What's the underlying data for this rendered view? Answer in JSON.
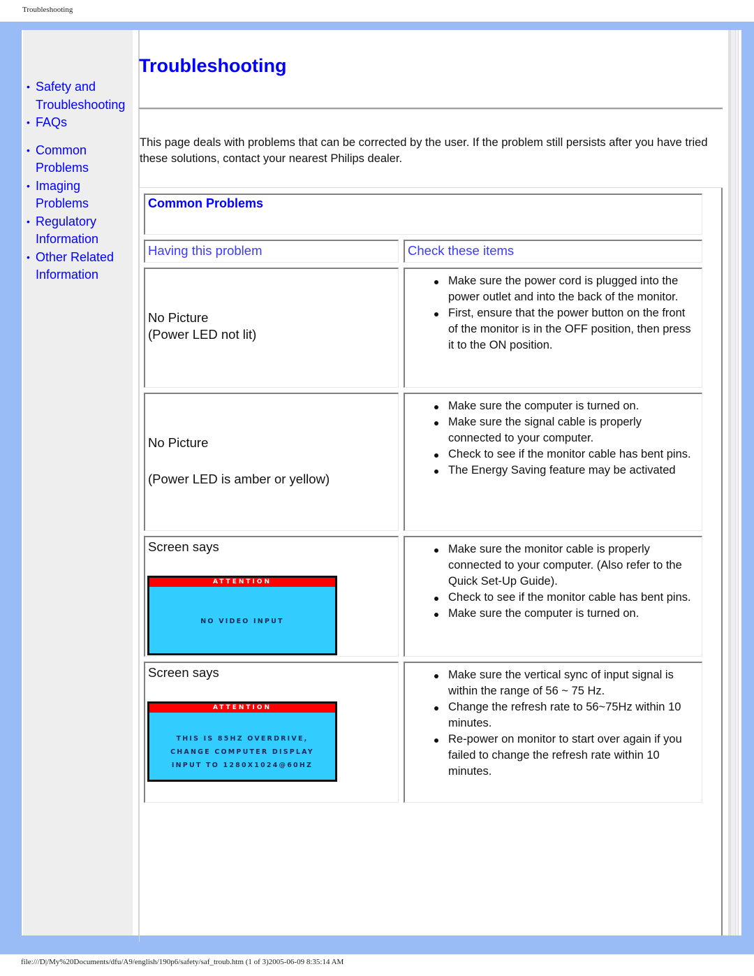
{
  "print_header": "Troubleshooting",
  "print_footer": "file:///D|/My%20Documents/dfu/A9/english/190p6/safety/saf_troub.htm (1 of 3)2005-06-09 8:35:14 AM",
  "sidebar": {
    "items": [
      {
        "label": "Safety and Troubleshooting"
      },
      {
        "label": "FAQs"
      },
      {
        "label": "Common Problems"
      },
      {
        "label": "Imaging Problems"
      },
      {
        "label": "Regulatory Information"
      },
      {
        "label": "Other Related Information"
      }
    ],
    "bullet": "•"
  },
  "page": {
    "title": "Troubleshooting",
    "intro": "This page deals with problems that can be corrected by the user. If the problem still persists after you have tried these solutions, contact your nearest Philips dealer."
  },
  "table": {
    "section_title": "Common Problems",
    "col_problem": "Having this problem",
    "col_check": "Check these items",
    "rows": [
      {
        "problem_lines": [
          "No Picture",
          "(Power LED not lit)"
        ],
        "checks": [
          "Make sure the power cord is plugged into the power outlet and into the back of the monitor.",
          "First, ensure that the power button on the front of the monitor is in the OFF position, then press it to the ON position."
        ]
      },
      {
        "problem_lines": [
          "No Picture",
          "(Power LED is amber or yellow)"
        ],
        "checks": [
          "Make sure the computer is turned on.",
          "Make sure the signal cable is properly connected to your computer.",
          "Check to see if the monitor cable has bent pins.",
          "The Energy Saving feature may be activated"
        ]
      },
      {
        "problem_lines": [
          "Screen says"
        ],
        "osd": {
          "header": "ATTENTION",
          "lines": [
            "NO VIDEO INPUT"
          ]
        },
        "checks": [
          "Make sure the monitor cable is properly connected to your computer. (Also refer to the Quick Set-Up Guide).",
          "Check to see if the monitor cable has bent pins.",
          "Make sure the computer is turned on."
        ]
      },
      {
        "problem_lines": [
          "Screen says"
        ],
        "osd": {
          "header": "ATTENTION",
          "lines": [
            "THIS IS 85HZ OVERDRIVE,",
            "CHANGE COMPUTER DISPLAY",
            "INPUT TO 1280X1024@60HZ"
          ]
        },
        "checks": [
          "Make sure the vertical sync of input signal is within the range of 56 ~ 75 Hz.",
          "Change the refresh rate to 56~75Hz within 10 minutes.",
          "Re-power on monitor to start over again if you failed to change the refresh rate within 10 minutes."
        ]
      }
    ]
  },
  "colors": {
    "frame": "#99bbf6",
    "link": "#0000ff",
    "osd_background": "#33ccff",
    "osd_header": "#ff0000"
  }
}
